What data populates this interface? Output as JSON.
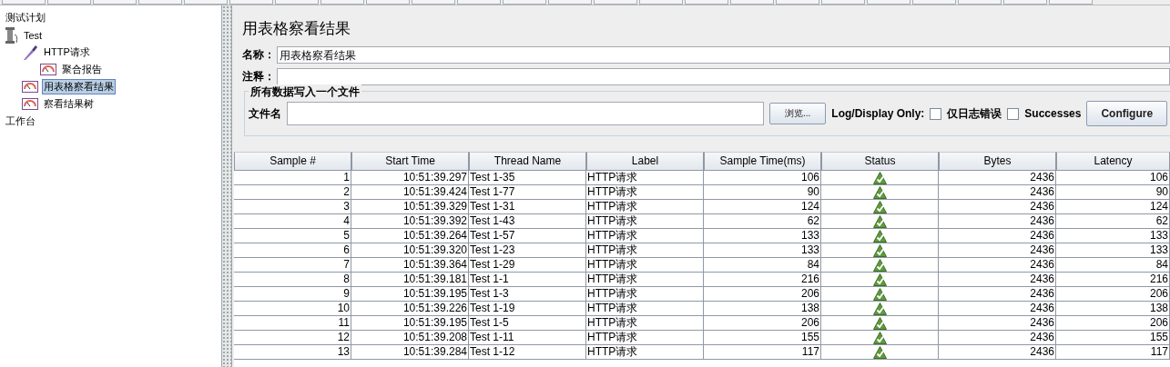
{
  "tree": [
    {
      "label": "测试计划",
      "selected": false,
      "children": [
        {
          "label": "Test",
          "kind": "thread-group",
          "selected": false,
          "children": [
            {
              "label": "HTTP请求",
              "kind": "sampler",
              "selected": false,
              "children": [
                {
                  "label": "聚合报告",
                  "kind": "listener",
                  "selected": false
                }
              ]
            },
            {
              "label": "用表格察看结果",
              "kind": "listener",
              "selected": true
            },
            {
              "label": "察看结果树",
              "kind": "listener",
              "selected": false
            }
          ]
        }
      ]
    },
    {
      "label": "工作台",
      "selected": false
    }
  ],
  "panel": {
    "title": "用表格察看结果",
    "name_label": "名称：",
    "name_value": "用表格察看结果",
    "comment_label": "注释：",
    "file_group": {
      "legend": "所有数据写入一个文件",
      "file_label": "文件名",
      "browse_button": "浏览...",
      "log_label": "Log/Display Only:",
      "checkboxes": [
        {
          "label": "仅日志错误",
          "checked": false
        },
        {
          "label": "Successes",
          "checked": false
        }
      ],
      "configure_button": "Configure"
    }
  },
  "table": {
    "columns": [
      "Sample #",
      "Start Time",
      "Thread Name",
      "Label",
      "Sample Time(ms)",
      "Status",
      "Bytes",
      "Latency"
    ],
    "rows": [
      {
        "cells": [
          "1",
          "10:51:39.297",
          "Test 1-35",
          "HTTP请求",
          "106"
        ],
        "kind": "success",
        "bytes": "2436",
        "latency": "106"
      },
      {
        "cells": [
          "2",
          "10:51:39.424",
          "Test 1-77",
          "HTTP请求",
          "90"
        ],
        "kind": "success",
        "bytes": "2436",
        "latency": "90"
      },
      {
        "cells": [
          "3",
          "10:51:39.329",
          "Test 1-31",
          "HTTP请求",
          "124"
        ],
        "kind": "success",
        "bytes": "2436",
        "latency": "124"
      },
      {
        "cells": [
          "4",
          "10:51:39.392",
          "Test 1-43",
          "HTTP请求",
          "62"
        ],
        "kind": "success",
        "bytes": "2436",
        "latency": "62"
      },
      {
        "cells": [
          "5",
          "10:51:39.264",
          "Test 1-57",
          "HTTP请求",
          "133"
        ],
        "kind": "success",
        "bytes": "2436",
        "latency": "133"
      },
      {
        "cells": [
          "6",
          "10:51:39.320",
          "Test 1-23",
          "HTTP请求",
          "133"
        ],
        "kind": "success",
        "bytes": "2436",
        "latency": "133"
      },
      {
        "cells": [
          "7",
          "10:51:39.364",
          "Test 1-29",
          "HTTP请求",
          "84"
        ],
        "kind": "success",
        "bytes": "2436",
        "latency": "84"
      },
      {
        "cells": [
          "8",
          "10:51:39.181",
          "Test 1-1",
          "HTTP请求",
          "216"
        ],
        "kind": "success",
        "bytes": "2436",
        "latency": "216"
      },
      {
        "cells": [
          "9",
          "10:51:39.195",
          "Test 1-3",
          "HTTP请求",
          "206"
        ],
        "kind": "success",
        "bytes": "2436",
        "latency": "206"
      },
      {
        "cells": [
          "10",
          "10:51:39.226",
          "Test 1-19",
          "HTTP请求",
          "138"
        ],
        "kind": "success",
        "bytes": "2436",
        "latency": "138"
      },
      {
        "cells": [
          "11",
          "10:51:39.195",
          "Test 1-5",
          "HTTP请求",
          "206"
        ],
        "kind": "success",
        "bytes": "2436",
        "latency": "206"
      },
      {
        "cells": [
          "12",
          "10:51:39.208",
          "Test 1-11",
          "HTTP请求",
          "155"
        ],
        "kind": "success",
        "bytes": "2436",
        "latency": "155"
      },
      {
        "cells": [
          "13",
          "10:51:39.284",
          "Test 1-12",
          "HTTP请求",
          "117"
        ],
        "kind": "success",
        "bytes": "2436",
        "latency": "117"
      }
    ]
  }
}
